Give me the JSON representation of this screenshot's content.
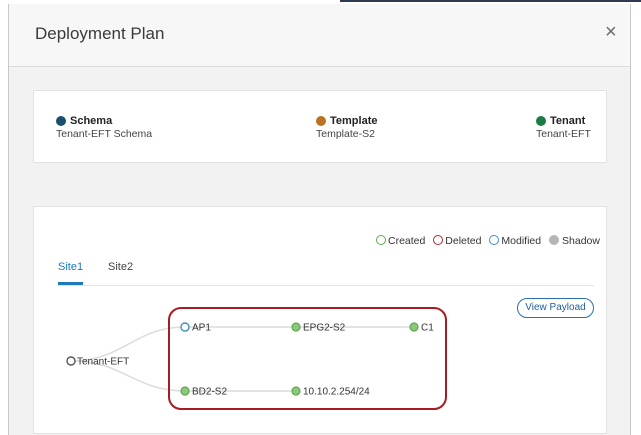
{
  "dialog": {
    "title": "Deployment Plan",
    "close_glyph": "×"
  },
  "summary": {
    "schema": {
      "label": "Schema",
      "value": "Tenant-EFT Schema",
      "color": "#1c4f6e"
    },
    "template": {
      "label": "Template",
      "value": "Template-S2",
      "color": "#b87220"
    },
    "tenant": {
      "label": "Tenant",
      "value": "Tenant-EFT",
      "color": "#1e7a43"
    }
  },
  "status_legend": {
    "created": {
      "label": "Created",
      "color": "#5aaa4c"
    },
    "deleted": {
      "label": "Deleted",
      "color": "#b8262b"
    },
    "modified": {
      "label": "Modified",
      "color": "#3f8fc5"
    },
    "shadow": {
      "label": "Shadow",
      "color": "#b5b5b5"
    }
  },
  "tabs": [
    {
      "label": "Site1",
      "active": true
    },
    {
      "label": "Site2",
      "active": false
    }
  ],
  "view_payload_label": "View Payload",
  "graph": {
    "nodes": {
      "root": {
        "label": "Tenant-EFT",
        "status": "none"
      },
      "ap": {
        "label": "AP1",
        "status": "modified"
      },
      "epg": {
        "label": "EPG2-S2",
        "status": "created"
      },
      "contract": {
        "label": "C1",
        "status": "created"
      },
      "bd": {
        "label": "BD2-S2",
        "status": "created"
      },
      "subnet": {
        "label": "10.10.2.254/24",
        "status": "created"
      }
    },
    "highlight_color": "#a61c22"
  }
}
